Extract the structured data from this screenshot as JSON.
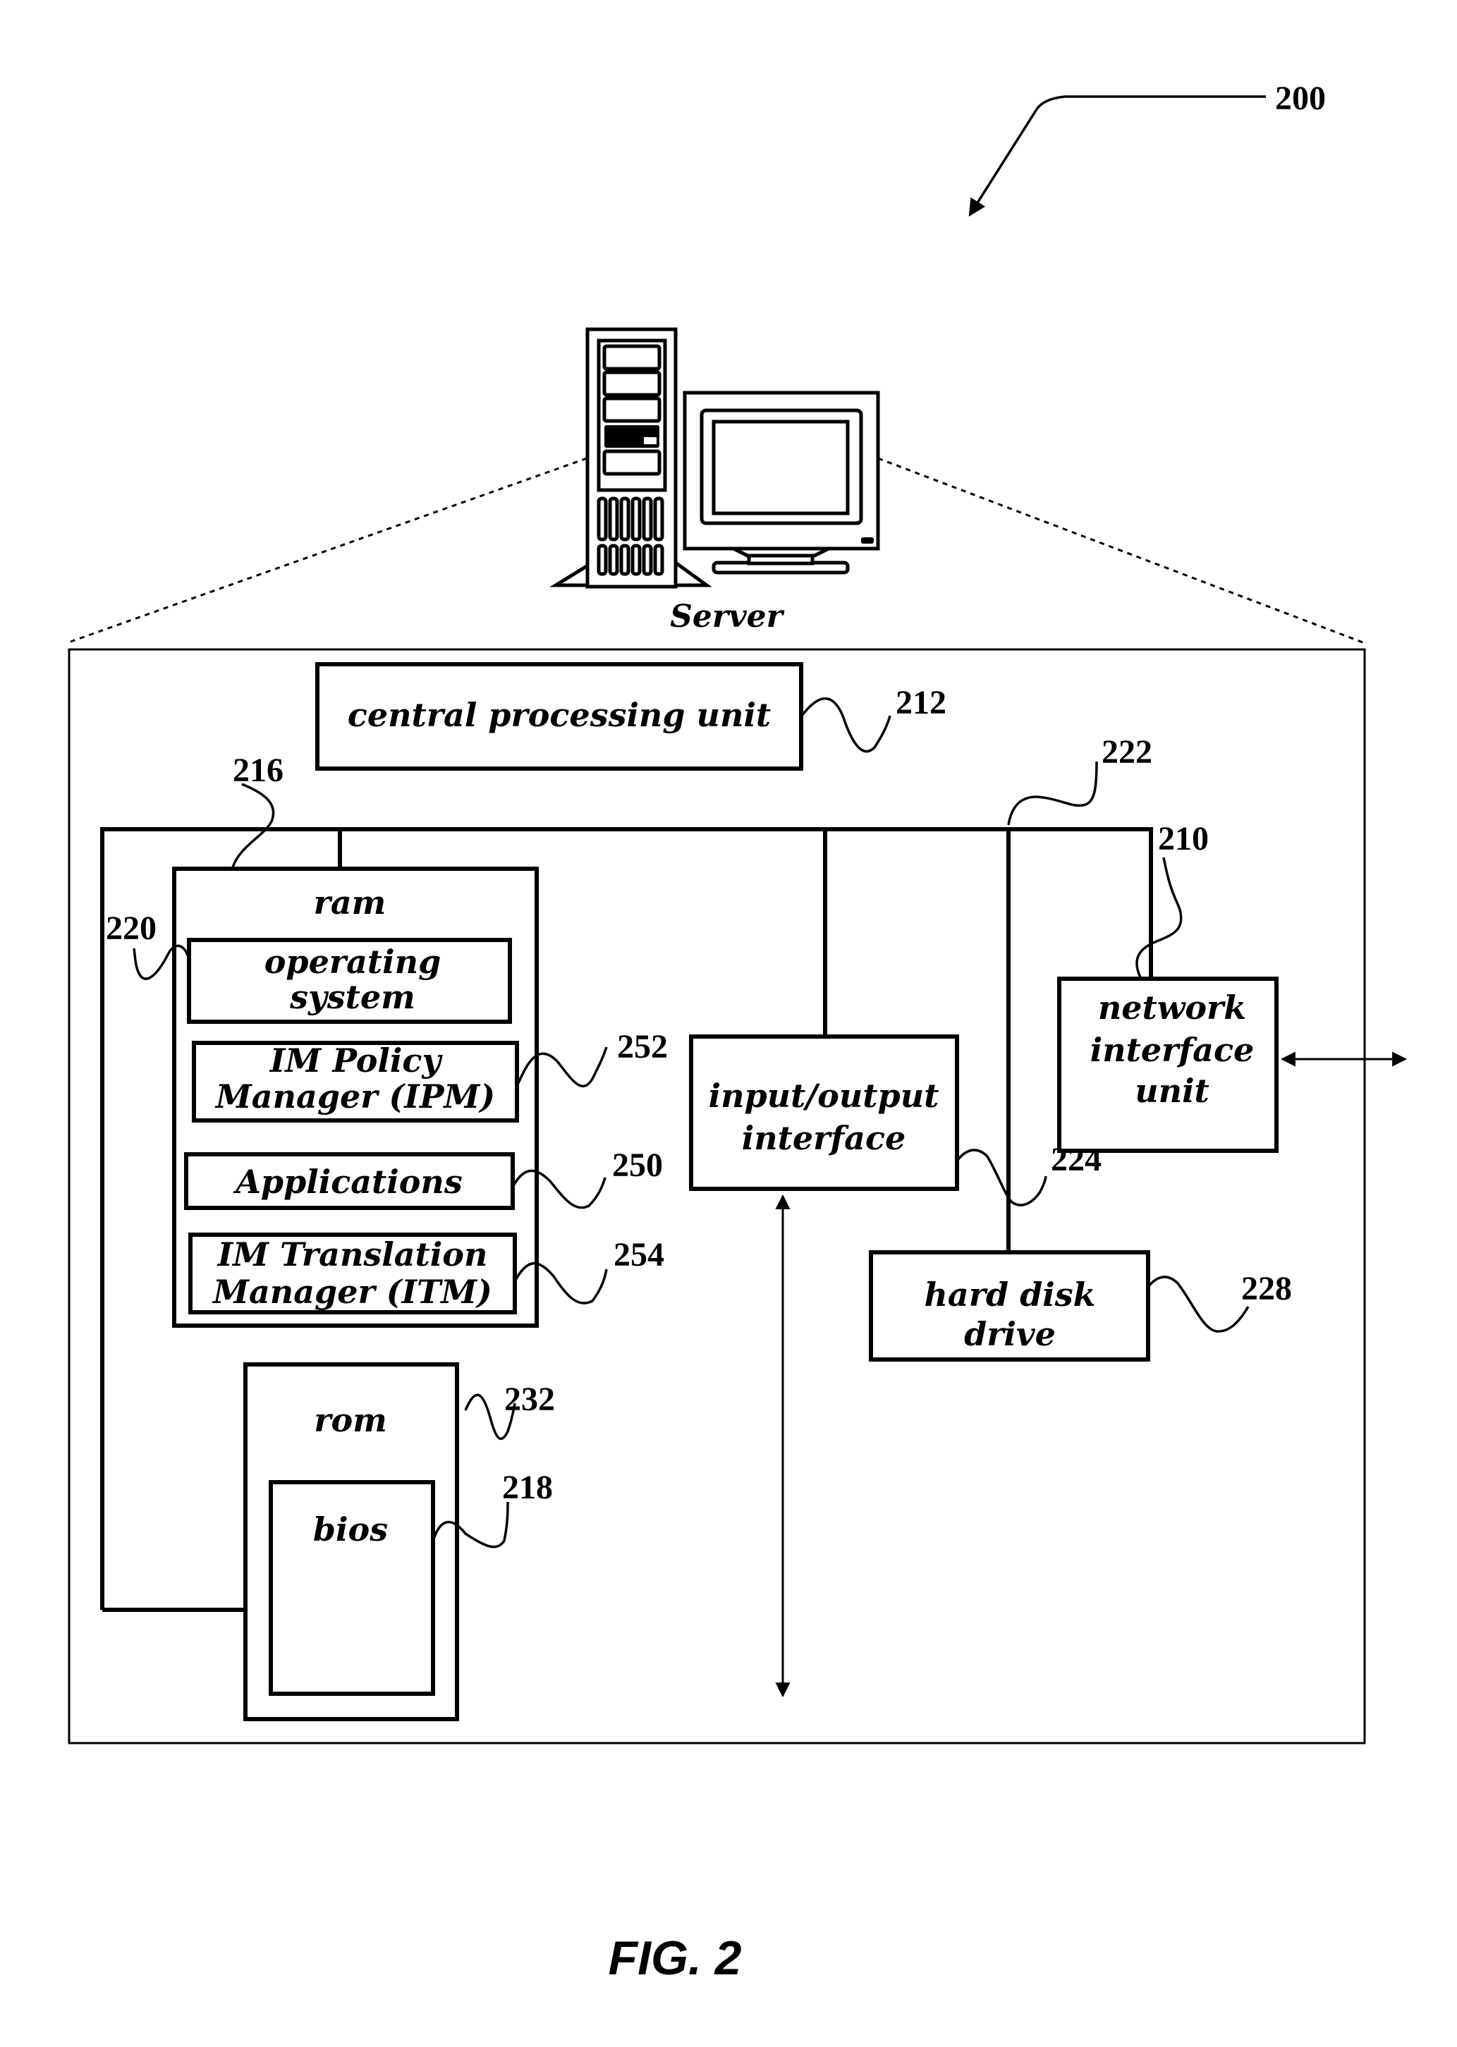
{
  "figure": {
    "caption": "FIG. 2",
    "reference": "200",
    "server_caption": "Server"
  },
  "components": {
    "cpu": {
      "label": "central processing unit",
      "ref": "212"
    },
    "ram": {
      "label": "ram",
      "ref": "216"
    },
    "os": {
      "line1": "operating",
      "line2": "system",
      "ref": "220"
    },
    "ipm": {
      "line1": "IM Policy",
      "line2": "Manager (IPM)",
      "ref": "252"
    },
    "apps": {
      "label": "Applications",
      "ref": "250"
    },
    "itm": {
      "line1": "IM Translation",
      "line2": "Manager (ITM)",
      "ref": "254"
    },
    "rom": {
      "label": "rom",
      "ref": "232"
    },
    "bios": {
      "label": "bios",
      "ref": "218"
    },
    "io": {
      "line1": "input/output",
      "line2": "interface",
      "ref": "224"
    },
    "bus": {
      "ref": "222"
    },
    "nic": {
      "line1": "network",
      "line2": "interface",
      "line3": "unit",
      "ref": "210"
    },
    "hdd": {
      "line1": "hard disk",
      "line2": "drive",
      "ref": "228"
    }
  }
}
